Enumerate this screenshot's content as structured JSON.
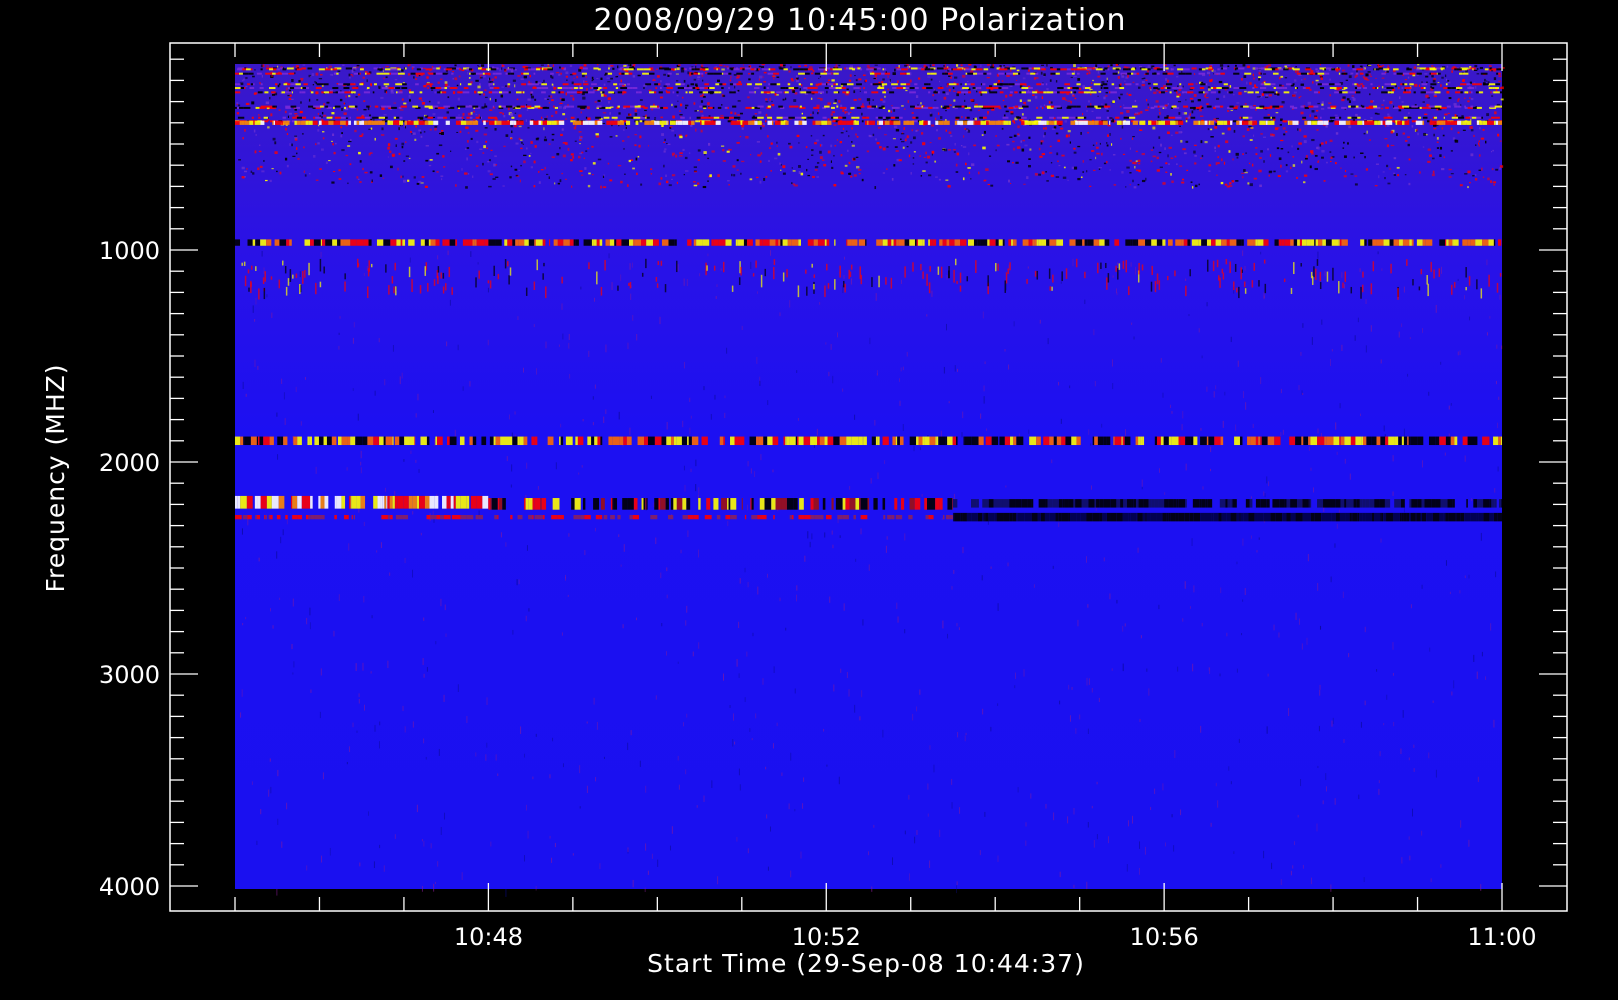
{
  "chart_data": {
    "type": "heatmap",
    "title": "2008/09/29 10:45:00 Polarization",
    "xlabel": "Start Time (29-Sep-08 10:44:37)",
    "ylabel": "Frequency (MHZ)",
    "x_range": [
      "10:45:00",
      "11:00:00"
    ],
    "y_range": [
      100,
      4000
    ],
    "y_ticks": [
      {
        "value": 1000,
        "label": "1000"
      },
      {
        "value": 2000,
        "label": "2000"
      },
      {
        "value": 3000,
        "label": "3000"
      },
      {
        "value": 4000,
        "label": "4000"
      }
    ],
    "x_ticks": [
      {
        "value": 3,
        "label": "10:48"
      },
      {
        "value": 7,
        "label": "10:52"
      },
      {
        "value": 11,
        "label": "10:56"
      },
      {
        "value": 15,
        "label": "11:00"
      }
    ],
    "x_minor_step_min": 1,
    "y_minor_step_mhz": 100,
    "colormap": [
      "#000000",
      "#0000ff",
      "#ff0000",
      "#ffff00",
      "#ffffff"
    ],
    "background_color": "#000000",
    "field_color": "#1a10f0",
    "features": [
      {
        "name": "noisy band",
        "f_min": 100,
        "f_max": 500,
        "t_min": 0,
        "t_max": 15
      },
      {
        "name": "bright line",
        "f_min": 390,
        "f_max": 410,
        "t_min": 0,
        "t_max": 15
      },
      {
        "name": "line",
        "f_min": 950,
        "f_max": 980,
        "t_min": 0,
        "t_max": 15
      },
      {
        "name": "line",
        "f_min": 1880,
        "f_max": 1920,
        "t_min": 0,
        "t_max": 15
      },
      {
        "name": "bright line",
        "f_min": 2160,
        "f_max": 2220,
        "t_min": 0,
        "t_max": 3
      },
      {
        "name": "dark line",
        "f_min": 2240,
        "f_max": 2280,
        "t_min": 8.5,
        "t_max": 15
      }
    ]
  }
}
